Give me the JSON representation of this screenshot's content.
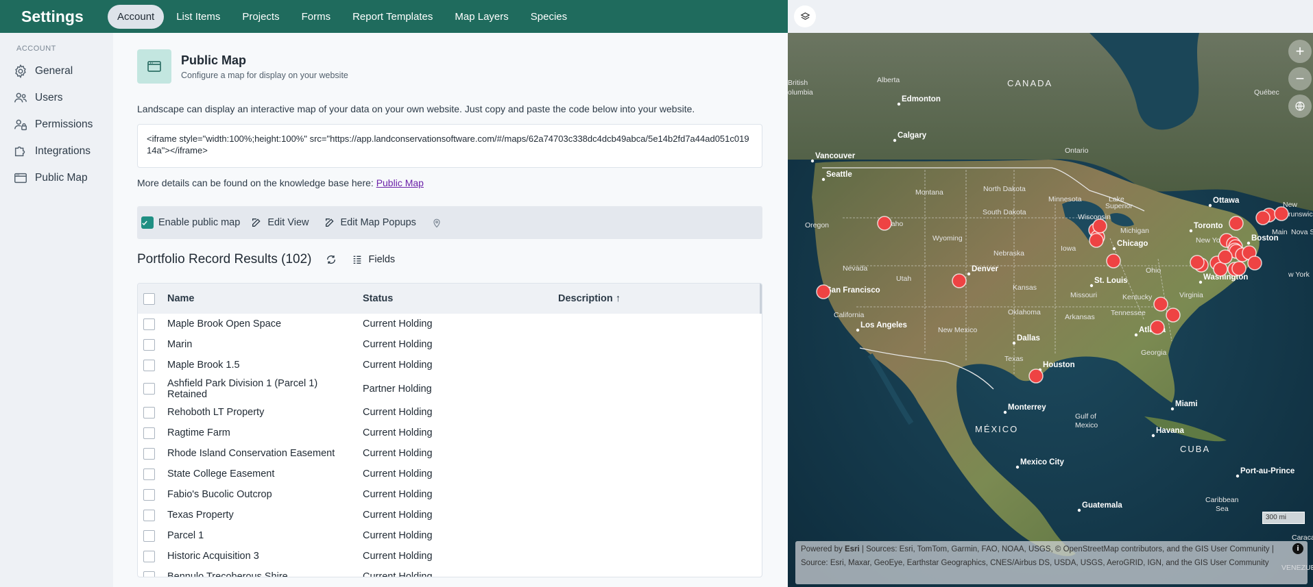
{
  "app": {
    "title": "Settings"
  },
  "nav": {
    "tabs": [
      {
        "label": "Account"
      },
      {
        "label": "List Items"
      },
      {
        "label": "Projects"
      },
      {
        "label": "Forms"
      },
      {
        "label": "Report Templates"
      },
      {
        "label": "Map Layers"
      },
      {
        "label": "Species"
      }
    ]
  },
  "sidebar": {
    "section": "ACCOUNT",
    "items": [
      {
        "label": "General",
        "icon": "gear-icon"
      },
      {
        "label": "Users",
        "icon": "users-icon"
      },
      {
        "label": "Permissions",
        "icon": "user-lock-icon"
      },
      {
        "label": "Integrations",
        "icon": "puzzle-icon"
      },
      {
        "label": "Public Map",
        "icon": "browser-window-icon"
      }
    ]
  },
  "page": {
    "title": "Public Map",
    "subtitle": "Configure a map for display on your website",
    "intro": "Landscape can display an interactive map of your data on your own website. Just copy and paste the code below into your website.",
    "embed_code": "<iframe style=\"width:100%;height:100%\" src=\"https://app.landconservationsoftware.com/#/maps/62a74703c338dc4dcb49abca/5e14b2fd7a44ad051c01914a\"></iframe>",
    "more_prefix": "More details can be found on the knowledge base here: ",
    "more_link": "Public Map"
  },
  "toolbar": {
    "enable_label": "Enable public map",
    "enabled": true,
    "edit_view": "Edit View",
    "edit_popups": "Edit Map Popups"
  },
  "results": {
    "title": "Portfolio Record Results (102)",
    "fields_label": "Fields",
    "columns": {
      "name": "Name",
      "status": "Status",
      "description": "Description",
      "sort_arrow": "↑"
    },
    "rows": [
      {
        "name": "Maple Brook Open Space",
        "status": "Current Holding"
      },
      {
        "name": "Marin",
        "status": "Current Holding"
      },
      {
        "name": "Maple Brook 1.5",
        "status": "Current Holding"
      },
      {
        "name": "Ashfield Park Division 1 (Parcel 1) Retained",
        "status": "Partner Holding"
      },
      {
        "name": "Rehoboth LT Property",
        "status": "Current Holding"
      },
      {
        "name": "Ragtime Farm",
        "status": "Current Holding"
      },
      {
        "name": "Rhode Island Conservation Easement",
        "status": "Current Holding"
      },
      {
        "name": "State College Easement",
        "status": "Current Holding"
      },
      {
        "name": "Fabio's Bucolic Outcrop",
        "status": "Current Holding"
      },
      {
        "name": "Texas Property",
        "status": "Current Holding"
      },
      {
        "name": "Parcel 1",
        "status": "Current Holding"
      },
      {
        "name": "Historic Acquisition 3",
        "status": "Current Holding"
      },
      {
        "name": "Bennulo Trecoberous Shire",
        "status": "Current Holding"
      }
    ]
  },
  "map": {
    "labels": [
      {
        "text": "CANADA",
        "cls": "country"
      },
      {
        "text": "Alberta"
      },
      {
        "text": "British"
      },
      {
        "text": "olumbia"
      },
      {
        "text": "Edmonton",
        "city": true
      },
      {
        "text": "Calgary",
        "city": true
      },
      {
        "text": "Vancouver",
        "city": true
      },
      {
        "text": "Seattle",
        "city": true
      },
      {
        "text": "Ontario"
      },
      {
        "text": "Québec"
      },
      {
        "text": "Ottawa",
        "city": true
      },
      {
        "text": "Toronto",
        "city": true
      },
      {
        "text": "Boston",
        "city": true
      },
      {
        "text": "New York"
      },
      {
        "text": "Washington",
        "city": true
      },
      {
        "text": "Chicago",
        "city": true
      },
      {
        "text": "St. Louis",
        "city": true
      },
      {
        "text": "Denver",
        "city": true
      },
      {
        "text": "San Francisco",
        "city": true
      },
      {
        "text": "Los Angeles",
        "city": true
      },
      {
        "text": "Dallas",
        "city": true
      },
      {
        "text": "Houston",
        "city": true
      },
      {
        "text": "Atlanta",
        "city": true
      },
      {
        "text": "Miami",
        "city": true
      },
      {
        "text": "Havana",
        "city": true
      },
      {
        "text": "Monterrey",
        "city": true
      },
      {
        "text": "Mexico City",
        "city": true
      },
      {
        "text": "Guatemala",
        "city": true
      },
      {
        "text": "Port-au-Prince",
        "city": true
      },
      {
        "text": "MÉXICO",
        "cls": "country"
      },
      {
        "text": "CUBA",
        "cls": "country"
      },
      {
        "text": "Montana"
      },
      {
        "text": "North Dakota"
      },
      {
        "text": "South Dakota"
      },
      {
        "text": "Minnesota"
      },
      {
        "text": "Wisconsin"
      },
      {
        "text": "Michigan"
      },
      {
        "text": "Wyoming"
      },
      {
        "text": "Nebraska"
      },
      {
        "text": "Iowa"
      },
      {
        "text": "Oregon"
      },
      {
        "text": "Nevada"
      },
      {
        "text": "Utah"
      },
      {
        "text": "California"
      },
      {
        "text": "Kansas"
      },
      {
        "text": "Missouri"
      },
      {
        "text": "Ohio"
      },
      {
        "text": "Kentucky"
      },
      {
        "text": "Virginia"
      },
      {
        "text": "Tennessee"
      },
      {
        "text": "Oklahoma"
      },
      {
        "text": "Arkansas"
      },
      {
        "text": "New Mexico"
      },
      {
        "text": "Texas"
      },
      {
        "text": "Georgia"
      },
      {
        "text": "Gulf of"
      },
      {
        "text": "Mexico"
      },
      {
        "text": "Caribbean"
      },
      {
        "text": "Sea"
      },
      {
        "text": "New"
      },
      {
        "text": "Brunswick"
      },
      {
        "text": "Nova S"
      },
      {
        "text": "Main"
      },
      {
        "text": "Lake"
      },
      {
        "text": "Superior"
      },
      {
        "text": "w York"
      },
      {
        "text": "Idaho"
      },
      {
        "text": "Caraca"
      },
      {
        "text": "VENEZUEL"
      }
    ],
    "scale": "300 mi",
    "attribution_lead": "Powered by ",
    "attribution_brand": "Esri",
    "attribution": " | Sources: Esri, TomTom, Garmin, FAO, NOAA, USGS, © OpenStreetMap contributors, and the GIS User Community | Source: Esri, Maxar, GeoEye, Earthstar Geographics, CNES/Airbus DS, USDA, USGS, AeroGRID, IGN, and the GIS User Community",
    "marker_color": "#ee4343",
    "zoom_in": "+",
    "zoom_out": "−",
    "info": "i"
  }
}
